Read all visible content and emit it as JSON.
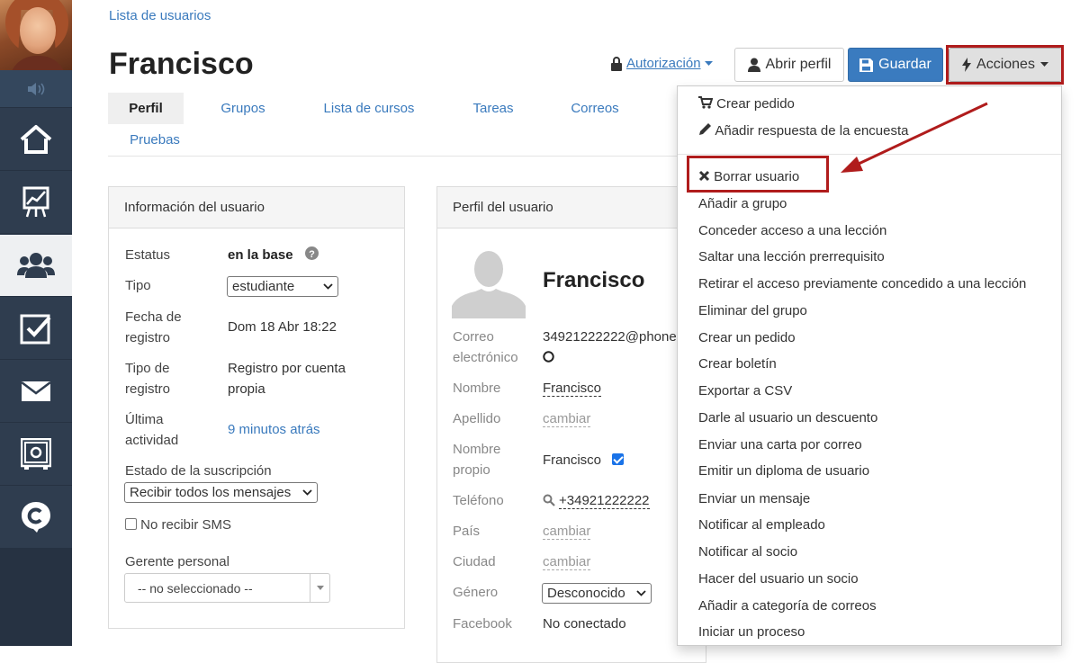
{
  "breadcrumb": "Lista de usuarios",
  "title": "Francisco",
  "header": {
    "authorization": "Autorización",
    "open_profile": "Abrir perfil",
    "save": "Guardar",
    "actions": "Acciones"
  },
  "tabs": [
    "Perfil",
    "Grupos",
    "Lista de cursos",
    "Tareas",
    "Correos",
    "Pruebas"
  ],
  "sidebar": {
    "icons": [
      "speaker-icon",
      "home-icon",
      "chart-icon",
      "users-icon",
      "checkbox-icon",
      "mail-icon",
      "safe-icon",
      "chat-c-icon"
    ]
  },
  "user_info": {
    "heading": "Información del usuario",
    "status_label": "Estatus",
    "status_value": "en la base",
    "type_label": "Tipo",
    "type_value": "estudiante",
    "reg_date_label_1": "Fecha de",
    "reg_date_label_2": "registro",
    "reg_date_value": "Dom 18 Abr 18:22",
    "reg_type_label_1": "Tipo de",
    "reg_type_label_2": "registro",
    "reg_type_value_1": "Registro por cuenta",
    "reg_type_value_2": "propia",
    "last_label_1": "Última",
    "last_label_2": "actividad",
    "last_value": "9 minutos atrás",
    "subscription_label": "Estado de la suscripción",
    "subscription_value": "Recibir todos los mensajes",
    "no_sms": "No recibir SMS",
    "manager_label": "Gerente personal",
    "manager_value": "-- no seleccionado --"
  },
  "profile": {
    "heading": "Perfil del usuario",
    "name": "Francisco",
    "email_label_1": "Correo",
    "email_label_2": "electrónico",
    "email_value": "34921222222@phone",
    "first_name_label": "Nombre",
    "first_name_value": "Francisco",
    "last_name_label": "Apellido",
    "change": "cambiar",
    "own_name_label_1": "Nombre",
    "own_name_label_2": "propio",
    "own_name_value": "Francisco",
    "phone_label": "Teléfono",
    "phone_value": "+34921222222",
    "country_label": "País",
    "city_label": "Ciudad",
    "gender_label": "Género",
    "gender_value": "Desconocido",
    "facebook_label": "Facebook",
    "facebook_value": "No conectado"
  },
  "actions_menu": {
    "top": [
      "Crear pedido",
      "Añadir respuesta de la encuesta"
    ],
    "items": [
      "Borrar usuario",
      "Añadir a grupo",
      "Conceder acceso a una lección",
      "Saltar una lección prerrequisito",
      "Retirar el acceso previamente concedido a una lección",
      "Eliminar del grupo",
      "Crear un pedido",
      "Crear boletín",
      "Exportar a CSV",
      "Darle al usuario un descuento",
      "Enviar una carta por correo",
      "Emitir un diploma de usuario",
      "Enviar un mensaje",
      "Notificar al empleado",
      "Notificar al socio",
      "Hacer del usuario un socio",
      "Añadir a categoría de correos",
      "Iniciar un proceso"
    ]
  },
  "colors": {
    "sidebar": "#2f3d4f",
    "link": "#3a7abd",
    "save_button": "#3a7bbf",
    "highlight": "#b01c1c"
  }
}
